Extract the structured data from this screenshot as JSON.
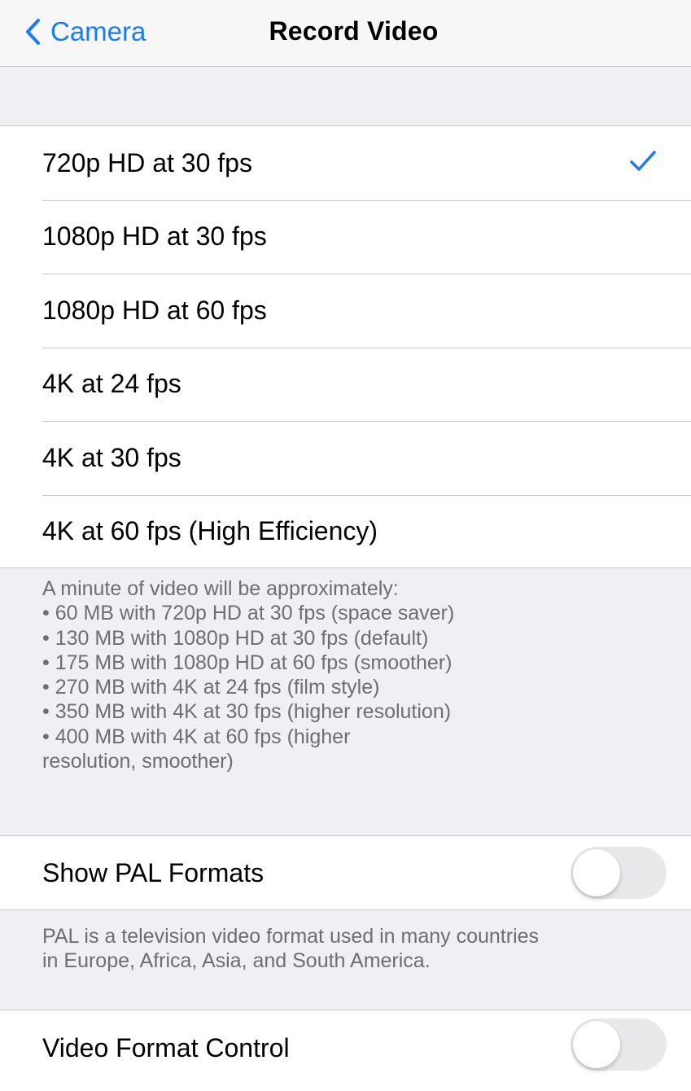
{
  "nav": {
    "back_label": "Camera",
    "title": "Record Video",
    "accent_color": "#1a7cf5"
  },
  "options": {
    "items": [
      {
        "label": "720p HD at 30 fps",
        "selected": true
      },
      {
        "label": "1080p HD at 30 fps",
        "selected": false
      },
      {
        "label": "1080p HD at 60 fps",
        "selected": false
      },
      {
        "label": "4K at 24 fps",
        "selected": false
      },
      {
        "label": "4K at 30 fps",
        "selected": false
      },
      {
        "label": "4K at 60 fps (High Efficiency)",
        "selected": false
      }
    ],
    "selected_icon": "checkmark-icon"
  },
  "size_footer": {
    "lines": [
      "A minute of video will be approximately:",
      "• 60 MB with 720p HD at 30 fps (space saver)",
      "• 130 MB with 1080p HD at 30 fps (default)",
      "• 175 MB with 1080p HD at 60 fps (smoother)",
      "• 270 MB with 4K at 24 fps (film style)",
      "• 350 MB with 4K at 30 fps (higher resolution)",
      "• 400 MB with 4K at 60 fps (higher",
      "resolution, smoother)"
    ]
  },
  "pal": {
    "label": "Show PAL Formats",
    "enabled": false,
    "footer_lines": [
      "PAL is a television video format used in many countries",
      "in Europe, Africa, Asia, and South America."
    ]
  },
  "format_control": {
    "label": "Video Format Control",
    "enabled": false
  }
}
